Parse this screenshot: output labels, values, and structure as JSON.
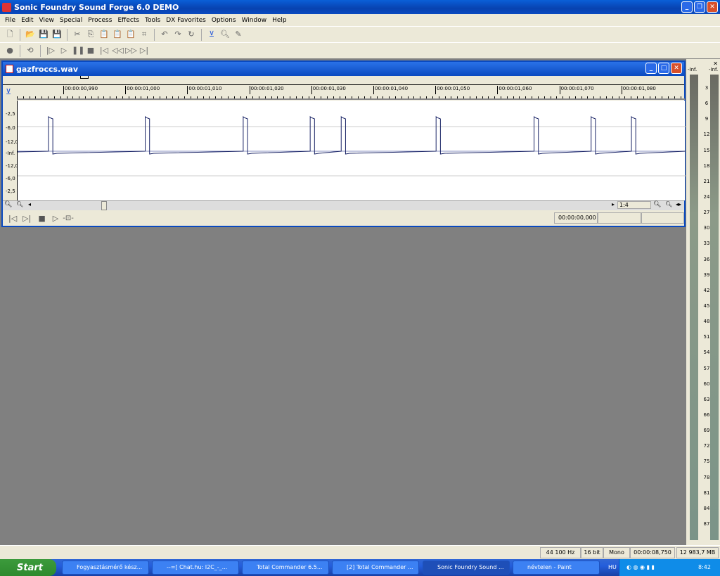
{
  "app": {
    "title": "Sonic Foundry Sound Forge 6.0 DEMO"
  },
  "menu": [
    "File",
    "Edit",
    "View",
    "Special",
    "Process",
    "Effects",
    "Tools",
    "DX Favorites",
    "Options",
    "Window",
    "Help"
  ],
  "toolbar1": [
    "new-icon",
    "open-icon",
    "save-icon",
    "save-as-icon",
    "cut-icon",
    "copy-icon",
    "paste-icon",
    "paste-mix-icon",
    "paste-crossfade-icon",
    "crop-icon",
    "undo-icon",
    "redo-icon",
    "repeat-icon",
    "edit-tool-icon",
    "magnify-tool-icon",
    "pencil-tool-icon"
  ],
  "toolbar2": [
    "record-icon",
    "loop-icon",
    "play-all-icon",
    "play-icon",
    "pause-icon",
    "stop-icon",
    "go-start-icon",
    "rewind-icon",
    "forward-icon",
    "go-end-icon"
  ],
  "document": {
    "title": "gazfroccs.wav",
    "ruler": [
      "00:00:00,990",
      "00:00:01,000",
      "00:00:01,010",
      "00:00:01,020",
      "00:00:01,030",
      "00:00:01,040",
      "00:00:01,050",
      "00:00:01,060",
      "00:00:01,070",
      "00:00:01,080"
    ],
    "y_labels": [
      "-2,5",
      "-6,0",
      "-12,0",
      "-Inf.",
      "-12,0",
      "-6,0",
      "-2,5"
    ],
    "waveform": {
      "pulse_start_s": [
        0.9875,
        1.0031,
        1.0189,
        1.0297,
        1.0347,
        1.05,
        1.0658,
        1.075,
        1.0815
      ],
      "pulse_width_s": 0.0007,
      "color": "#1a2466"
    },
    "zoom_ratio": "1:4",
    "cursor_time": "00:00:00,000"
  },
  "meter": {
    "top_labels": [
      "-Inf.",
      "-Inf."
    ],
    "scale": [
      "3",
      "6",
      "9",
      "12",
      "15",
      "18",
      "21",
      "24",
      "27",
      "30",
      "33",
      "36",
      "39",
      "42",
      "45",
      "48",
      "51",
      "54",
      "57",
      "60",
      "63",
      "66",
      "69",
      "72",
      "75",
      "78",
      "81",
      "84",
      "87"
    ]
  },
  "status": {
    "sample_rate": "44 100 Hz",
    "bit_depth": "16 bit",
    "channels": "Mono",
    "length": "00:00:08,750",
    "free_space": "12 983,7 MB"
  },
  "taskbar": {
    "start": "Start",
    "tasks": [
      "Fogyasztásmérő kész...",
      "--=[ Chat.hu: I2C_-_...",
      "Total Commander 6.5...",
      "[2] Total Commander ...",
      "Sonic Foundry Sound ...",
      "névtelen - Paint"
    ],
    "lang": "HU",
    "clock": "8:42"
  }
}
